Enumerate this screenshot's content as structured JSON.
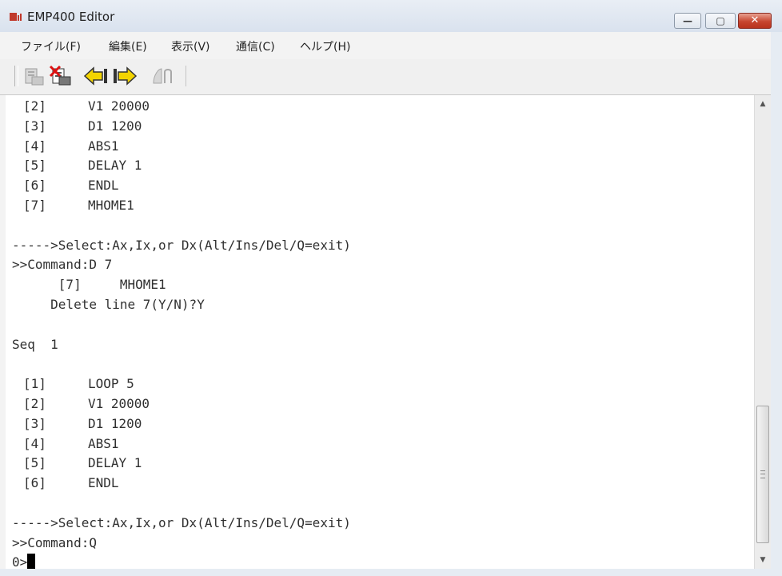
{
  "window": {
    "title": "EMP400 Editor",
    "controls": {
      "minimize": "—",
      "maximize": "▢",
      "close": "✕"
    }
  },
  "menu": [
    {
      "label": "ファイル(F)"
    },
    {
      "label": "編集(E)"
    },
    {
      "label": "表示(V)"
    },
    {
      "label": "通信(C)"
    },
    {
      "label": "ヘルプ(H)"
    }
  ],
  "toolbar": {
    "buttons": [
      {
        "icon": "upload-icon",
        "enabled": false
      },
      {
        "icon": "delete-transfer-icon",
        "enabled": true
      },
      {
        "icon": "arrow-left-icon",
        "enabled": true
      },
      {
        "icon": "arrow-right-icon",
        "enabled": true
      },
      {
        "icon": "disconnect-icon",
        "enabled": false
      }
    ]
  },
  "console": {
    "lines": [
      {
        "idx": "[2]",
        "cmd": "V1 20000"
      },
      {
        "idx": "[3]",
        "cmd": "D1 1200"
      },
      {
        "idx": "[4]",
        "cmd": "ABS1"
      },
      {
        "idx": "[5]",
        "cmd": "DELAY 1"
      },
      {
        "idx": "[6]",
        "cmd": "ENDL"
      },
      {
        "idx": "[7]",
        "cmd": "MHOME1"
      },
      {
        "text": ""
      },
      {
        "text": "----->Select:Ax,Ix,or Dx(Alt/Ins/Del/Q=exit)"
      },
      {
        "text": ">>Command:D 7"
      },
      {
        "text": "      [7]     MHOME1"
      },
      {
        "text": "     Delete line 7(Y/N)?Y"
      },
      {
        "text": ""
      },
      {
        "text": "Seq  1"
      },
      {
        "text": ""
      },
      {
        "idx": "[1]",
        "cmd": "LOOP 5"
      },
      {
        "idx": "[2]",
        "cmd": "V1 20000"
      },
      {
        "idx": "[3]",
        "cmd": "D1 1200"
      },
      {
        "idx": "[4]",
        "cmd": "ABS1"
      },
      {
        "idx": "[5]",
        "cmd": "DELAY 1"
      },
      {
        "idx": "[6]",
        "cmd": "ENDL"
      },
      {
        "text": ""
      },
      {
        "text": "----->Select:Ax,Ix,or Dx(Alt/Ins/Del/Q=exit)"
      },
      {
        "text": ">>Command:Q"
      }
    ],
    "prompt": "0>"
  },
  "scrollbar": {
    "up_arrow": "▲",
    "down_arrow": "▼"
  }
}
